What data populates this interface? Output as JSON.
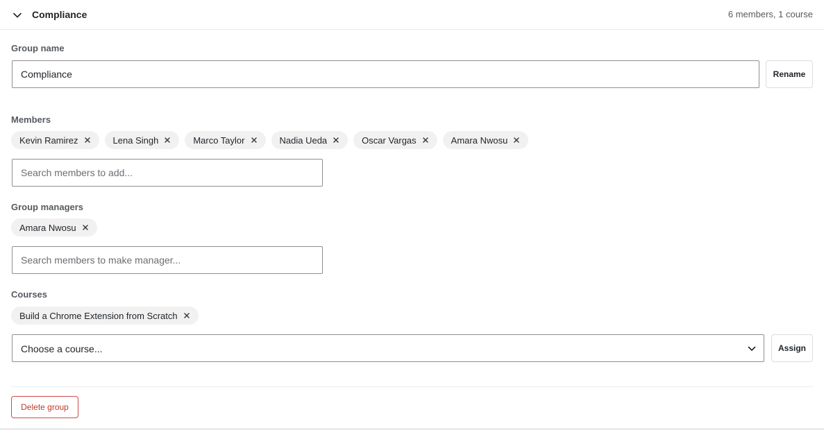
{
  "group": {
    "title": "Compliance",
    "summary": "6 members, 1 course",
    "name_label": "Group name",
    "name_value": "Compliance",
    "rename_label": "Rename"
  },
  "members": {
    "label": "Members",
    "chips": [
      "Kevin Ramirez",
      "Lena Singh",
      "Marco Taylor",
      "Nadia Ueda",
      "Oscar Vargas",
      "Amara Nwosu"
    ],
    "search_placeholder": "Search members to add..."
  },
  "managers": {
    "label": "Group managers",
    "chips": [
      "Amara Nwosu"
    ],
    "search_placeholder": "Search members to make manager..."
  },
  "courses": {
    "label": "Courses",
    "chips": [
      "Build a Chrome Extension from Scratch"
    ],
    "select_value": "Choose a course...",
    "assign_label": "Assign"
  },
  "actions": {
    "delete_label": "Delete group"
  },
  "icons": {
    "collapse": "chevron-down-icon",
    "remove": "close-icon",
    "select": "chevron-down-icon"
  },
  "colors": {
    "danger": "#c0392b",
    "chip_bg": "#f1f1f1"
  }
}
